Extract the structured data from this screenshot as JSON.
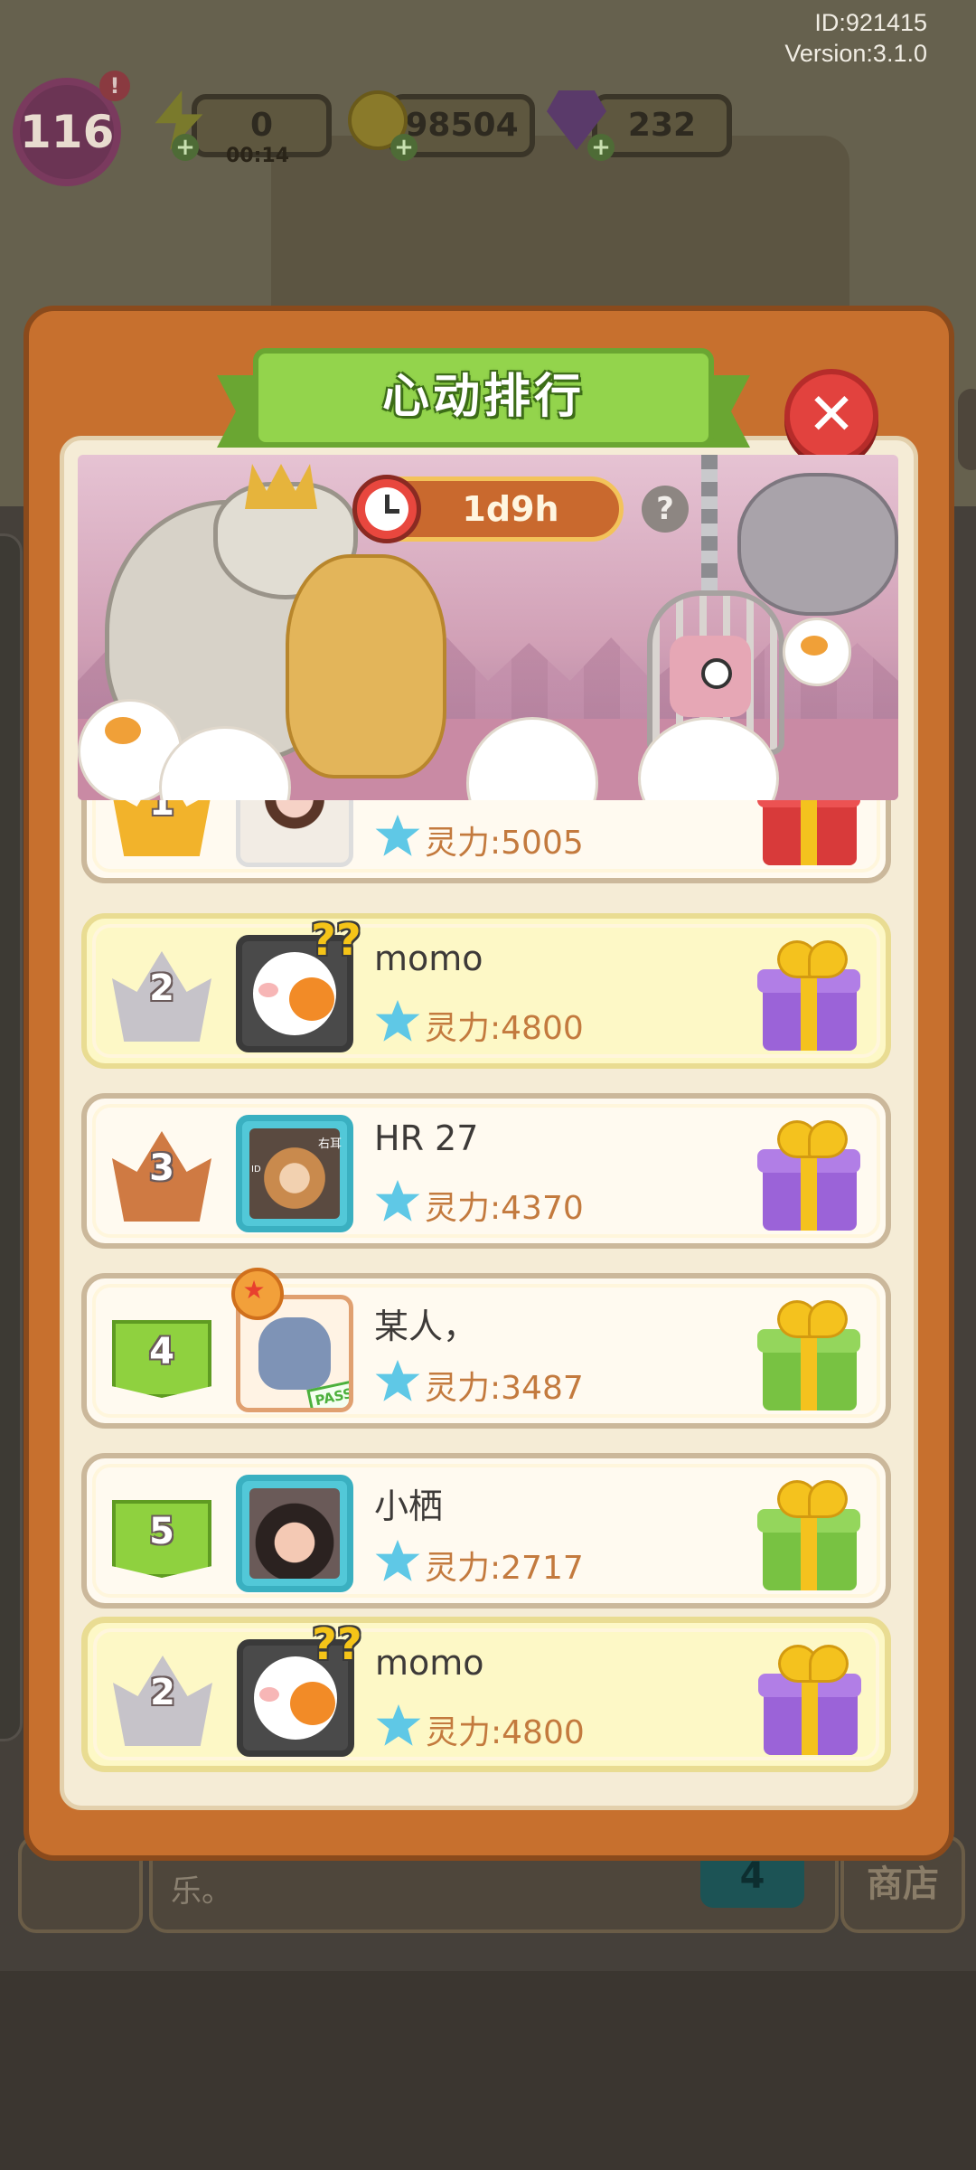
{
  "hud": {
    "id_text": "ID:921415",
    "version_text": "Version:3.1.0",
    "level": "116",
    "alert": "!",
    "energy": "0",
    "energy_timer": "00:14",
    "coins": "98504",
    "gems": "232",
    "plus": "+"
  },
  "background": {
    "chat_text": "乐。",
    "teal_badge": "4",
    "shop_label": "商店"
  },
  "modal": {
    "title": "心动排行",
    "close_symbol": "✕",
    "timer": "1d9h",
    "help_symbol": "?"
  },
  "leaderboard": [
    {
      "rank": "1",
      "name": "",
      "power": "灵力:5005",
      "gift": "red",
      "badge": "gold",
      "highlight": false
    },
    {
      "rank": "2",
      "name": "momo",
      "power": "灵力:4800",
      "gift": "purple",
      "badge": "silver",
      "highlight": true
    },
    {
      "rank": "3",
      "name": "HR 27",
      "power": "灵力:4370",
      "gift": "purple",
      "badge": "bronze",
      "highlight": false
    },
    {
      "rank": "4",
      "name": "某人，",
      "power": "灵力:3487",
      "gift": "green",
      "badge": "flag",
      "highlight": false
    },
    {
      "rank": "5",
      "name": "小栖",
      "power": "灵力:2717",
      "gift": "green",
      "badge": "flag",
      "highlight": false
    }
  ],
  "my_rank": {
    "rank": "2",
    "name": "momo",
    "power": "灵力:4800",
    "gift": "purple",
    "badge": "silver"
  },
  "avatar_labels": {
    "dog_caption_left": "ID",
    "dog_caption_right": "右耳",
    "pass_stamp": "PASS",
    "question_marks": "??",
    "medal_star": "★"
  },
  "colors": {
    "modal_orange": "#c7702e",
    "banner_green": "#93d44c",
    "close_red": "#e2423e",
    "power_text": "#c37a3e",
    "power_star": "#5fc8e6"
  }
}
